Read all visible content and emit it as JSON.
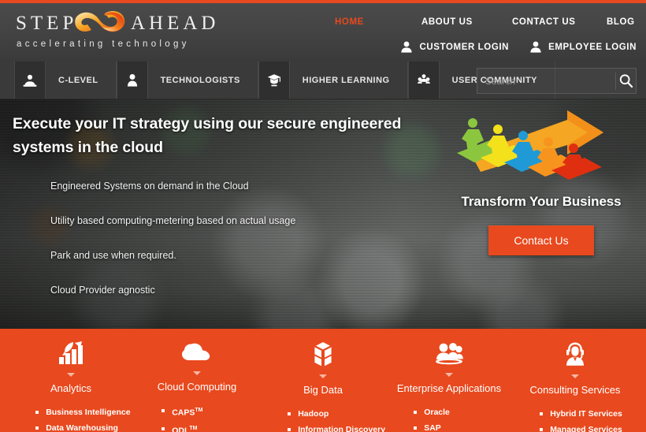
{
  "brand": {
    "word_one": "STEP",
    "word_two": "AHEAD",
    "tagline": "accelerating technology",
    "accent_color": "#e8491e"
  },
  "main_nav": {
    "items": [
      {
        "label": "HOME",
        "active": true
      },
      {
        "label": "ABOUT US",
        "active": false
      },
      {
        "label": "CONTACT US",
        "active": false
      },
      {
        "label": "BLOG",
        "active": false
      }
    ]
  },
  "login_nav": {
    "items": [
      {
        "label": "CUSTOMER LOGIN",
        "icon": "user-icon"
      },
      {
        "label": "EMPLOYEE LOGIN",
        "icon": "user-icon"
      }
    ]
  },
  "sub_nav": {
    "items": [
      {
        "label": "C-LEVEL",
        "icon": "executive-user-icon"
      },
      {
        "label": "TECHNOLOGISTS",
        "icon": "person-icon"
      },
      {
        "label": "HIGHER LEARNING",
        "icon": "graduation-cap-icon"
      },
      {
        "label": "USER COMMUNITY",
        "icon": "group-icon"
      }
    ]
  },
  "search": {
    "value": "",
    "placeholder": "Search",
    "icon": "search-icon"
  },
  "hero": {
    "title": "Execute your IT strategy using our secure engineered systems in the cloud",
    "bullets": [
      "Engineered Systems on demand in the Cloud",
      "Utility based computing-metering based on actual usage",
      "Park and use when required.",
      "Cloud Provider agnostic"
    ],
    "subheading": "Transform Your Business",
    "cta_label": "Contact Us",
    "artwork": "running-people-arrow-graphic"
  },
  "services": {
    "columns": [
      {
        "title": "Analytics",
        "icon": "bar-chart-rocket-icon",
        "items": [
          {
            "text": "Business Intelligence",
            "tm": ""
          },
          {
            "text": "Data Warehousing",
            "tm": ""
          }
        ]
      },
      {
        "title": "Cloud Computing",
        "icon": "cloud-icon",
        "items": [
          {
            "text": "CAPS",
            "tm": "TM"
          },
          {
            "text": "ODL",
            "tm": "TM"
          }
        ]
      },
      {
        "title": "Big Data",
        "icon": "cube-blocks-icon",
        "items": [
          {
            "text": "Hadoop",
            "tm": ""
          },
          {
            "text": "Information Discovery",
            "tm": ""
          }
        ]
      },
      {
        "title": "Enterprise Applications",
        "icon": "people-group-icon",
        "items": [
          {
            "text": "Oracle",
            "tm": ""
          },
          {
            "text": "SAP",
            "tm": ""
          }
        ]
      },
      {
        "title": "Consulting Services",
        "icon": "headset-agent-icon",
        "items": [
          {
            "text": "Hybrid IT Services",
            "tm": ""
          },
          {
            "text": "Managed Services",
            "tm": ""
          }
        ]
      }
    ]
  }
}
